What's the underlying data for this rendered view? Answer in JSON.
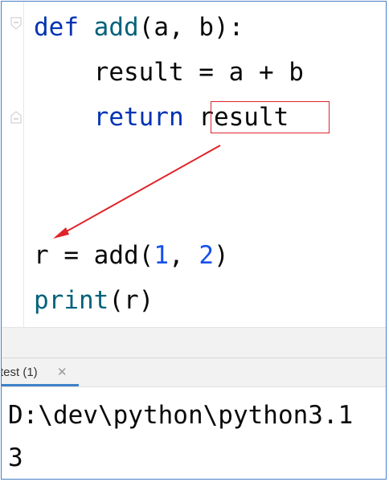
{
  "editor": {
    "lines": [
      {
        "parts": [
          [
            "kw",
            "def"
          ],
          [
            "txt",
            " "
          ],
          [
            "fn",
            "add"
          ],
          [
            "txt",
            "(a, b):"
          ]
        ]
      },
      {
        "parts": [
          [
            "txt",
            "    result = a + b"
          ]
        ]
      },
      {
        "parts": [
          [
            "txt",
            "    "
          ],
          [
            "kw",
            "return"
          ],
          [
            "txt",
            " result"
          ]
        ]
      },
      {
        "parts": [
          [
            "txt",
            ""
          ]
        ]
      },
      {
        "parts": [
          [
            "txt",
            ""
          ]
        ]
      },
      {
        "parts": [
          [
            "txt",
            "r = add("
          ],
          [
            "num",
            "1"
          ],
          [
            "txt",
            ", "
          ],
          [
            "num",
            "2"
          ],
          [
            "txt",
            ")"
          ]
        ]
      },
      {
        "parts": [
          [
            "fn",
            "print"
          ],
          [
            "txt",
            "(r)"
          ]
        ]
      }
    ],
    "highlighted_token": "result"
  },
  "run_tab": {
    "label": "test (1)",
    "close_icon": "close-icon"
  },
  "console": {
    "command": "D:\\dev\\python\\python3.1",
    "output": "3"
  },
  "colors": {
    "keyword": "#0033b3",
    "function": "#00627a",
    "number": "#1750eb",
    "highlight_box": "#e0242a",
    "arrow": "#e0242a",
    "frame_border": "#4a7fc8",
    "tab_underline": "#4083c9"
  }
}
